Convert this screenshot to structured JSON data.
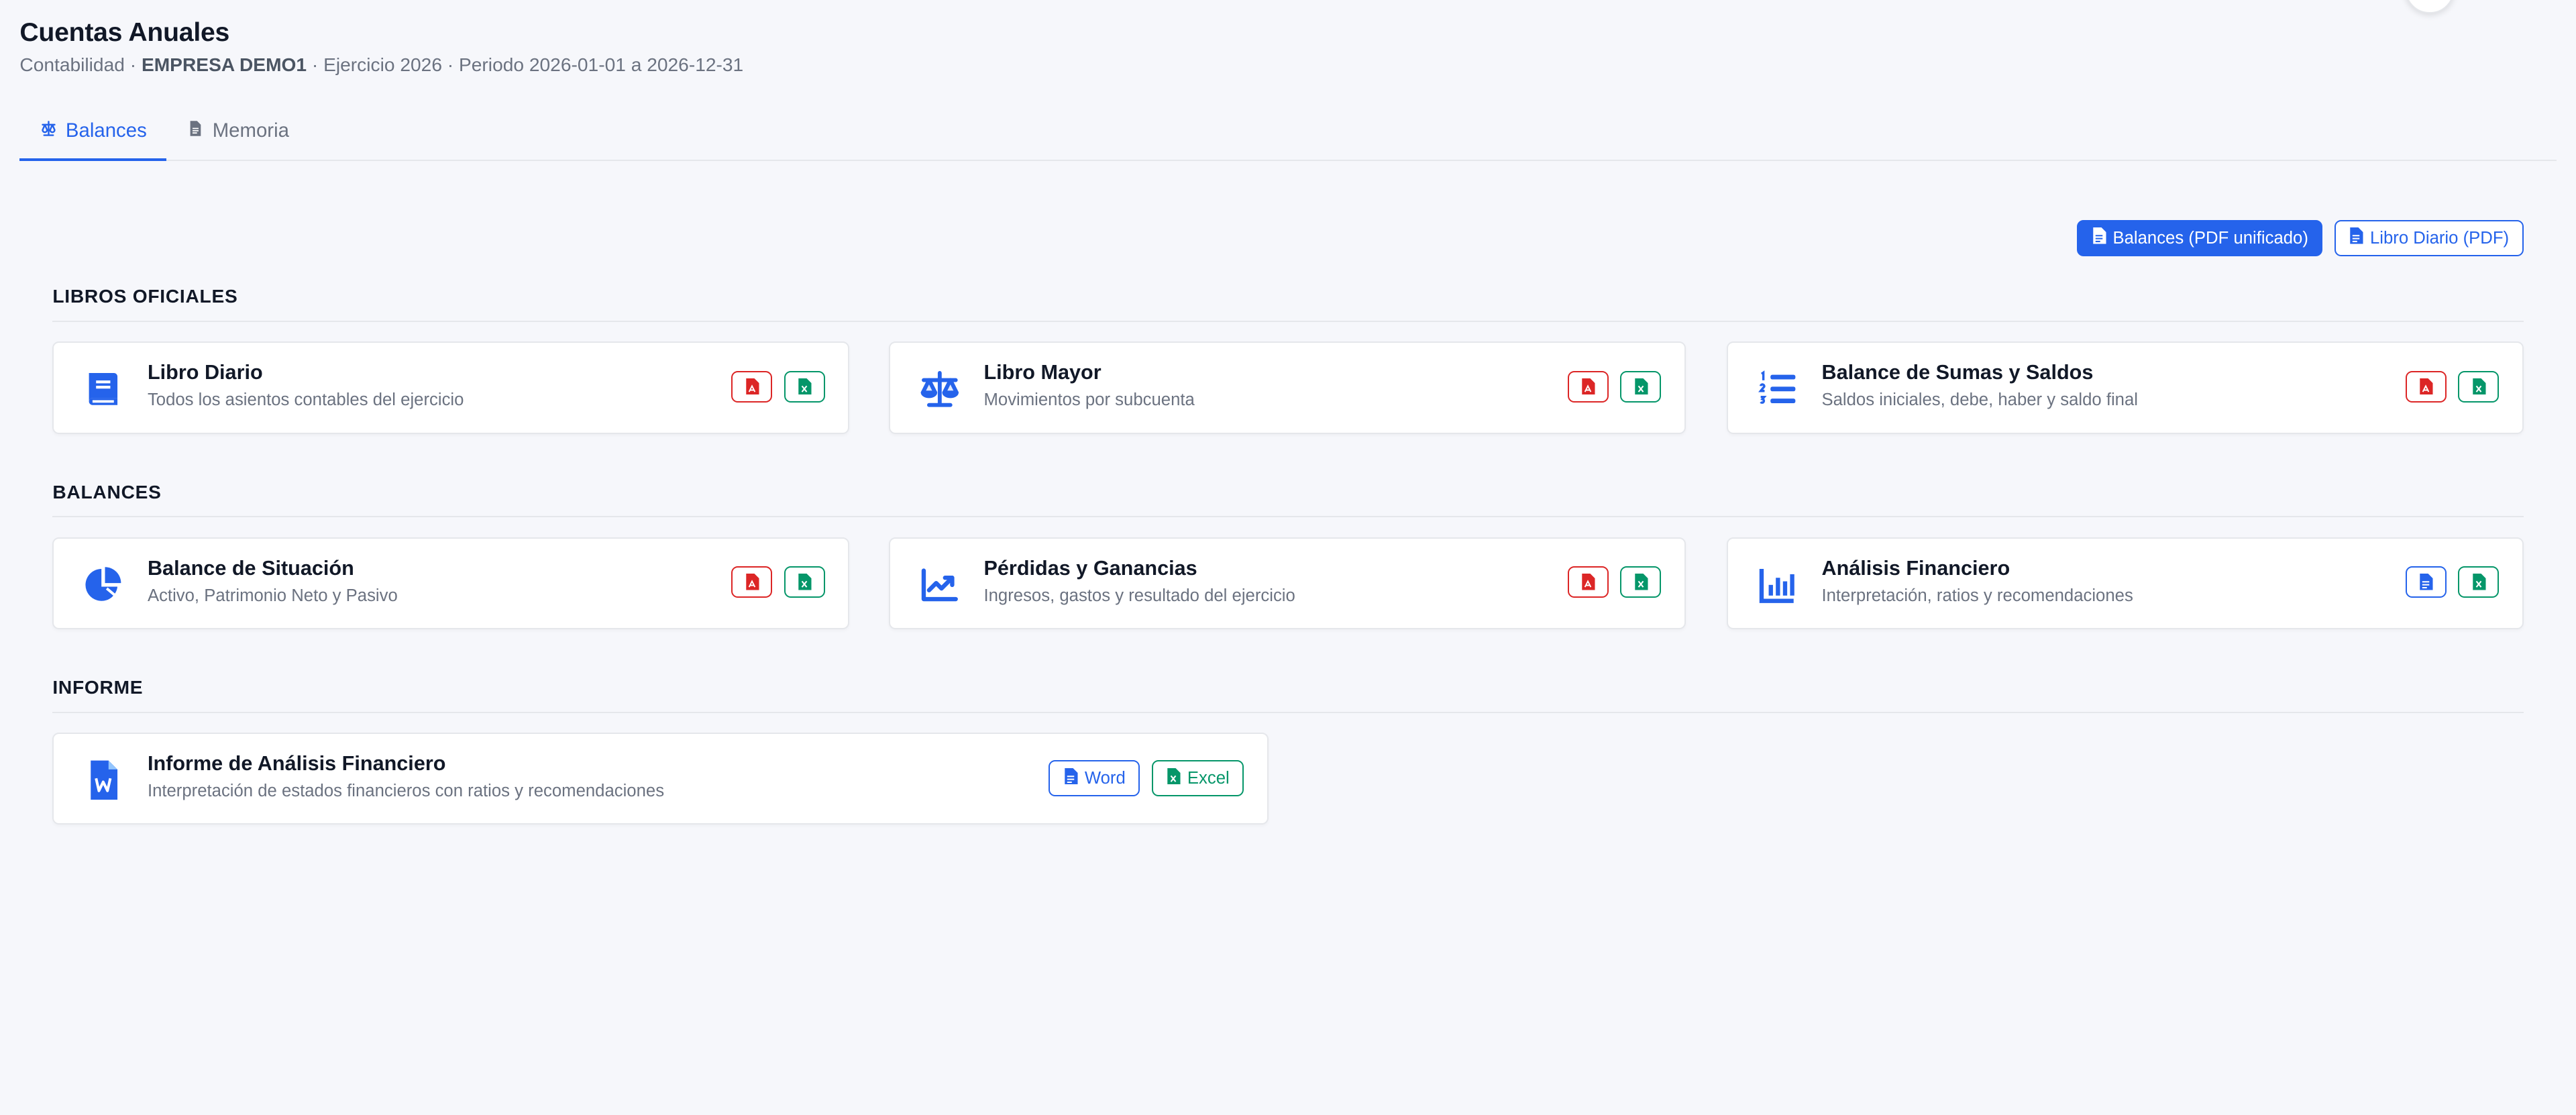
{
  "header": {
    "title": "Cuentas Anuales",
    "subtitle_prefix": "Contabilidad · ",
    "company": "EMPRESA DEMO1",
    "subtitle_suffix": " · Ejercicio 2026 · Periodo 2026-01-01 a 2026-12-31"
  },
  "tabs": [
    {
      "label": "Balances",
      "icon": "scale-icon",
      "active": true
    },
    {
      "label": "Memoria",
      "icon": "file-icon",
      "active": false
    }
  ],
  "toolbar": {
    "balances_pdf_label": "Balances (PDF unificado)",
    "libro_diario_pdf_label": "Libro Diario (PDF)"
  },
  "sections": {
    "libros_oficiales": "LIBROS OFICIALES",
    "balances": "BALANCES",
    "informe": "INFORME"
  },
  "cards": {
    "libro_diario": {
      "title": "Libro Diario",
      "desc": "Todos los asientos contables del ejercicio",
      "icon": "book-icon"
    },
    "libro_mayor": {
      "title": "Libro Mayor",
      "desc": "Movimientos por subcuenta",
      "icon": "scale-icon"
    },
    "sumas_saldos": {
      "title": "Balance de Sumas y Saldos",
      "desc": "Saldos iniciales, debe, haber y saldo final",
      "icon": "numbered-list-icon"
    },
    "situacion": {
      "title": "Balance de Situación",
      "desc": "Activo, Patrimonio Neto y Pasivo",
      "icon": "pie-chart-icon"
    },
    "perdidas": {
      "title": "Pérdidas y Ganancias",
      "desc": "Ingresos, gastos y resultado del ejercicio",
      "icon": "line-chart-icon"
    },
    "analisis": {
      "title": "Análisis Financiero",
      "desc": "Interpretación, ratios y recomendaciones",
      "icon": "bar-chart-icon"
    },
    "informe": {
      "title": "Informe de Análisis Financiero",
      "desc": "Interpretación de estados financieros con ratios y recomendaciones",
      "icon": "word-file-icon",
      "word_label": "Word",
      "excel_label": "Excel"
    }
  },
  "colors": {
    "accent": "#2563eb",
    "pdf_red": "#dc2626",
    "excel_green": "#059669",
    "background": "#f6f7fb"
  }
}
